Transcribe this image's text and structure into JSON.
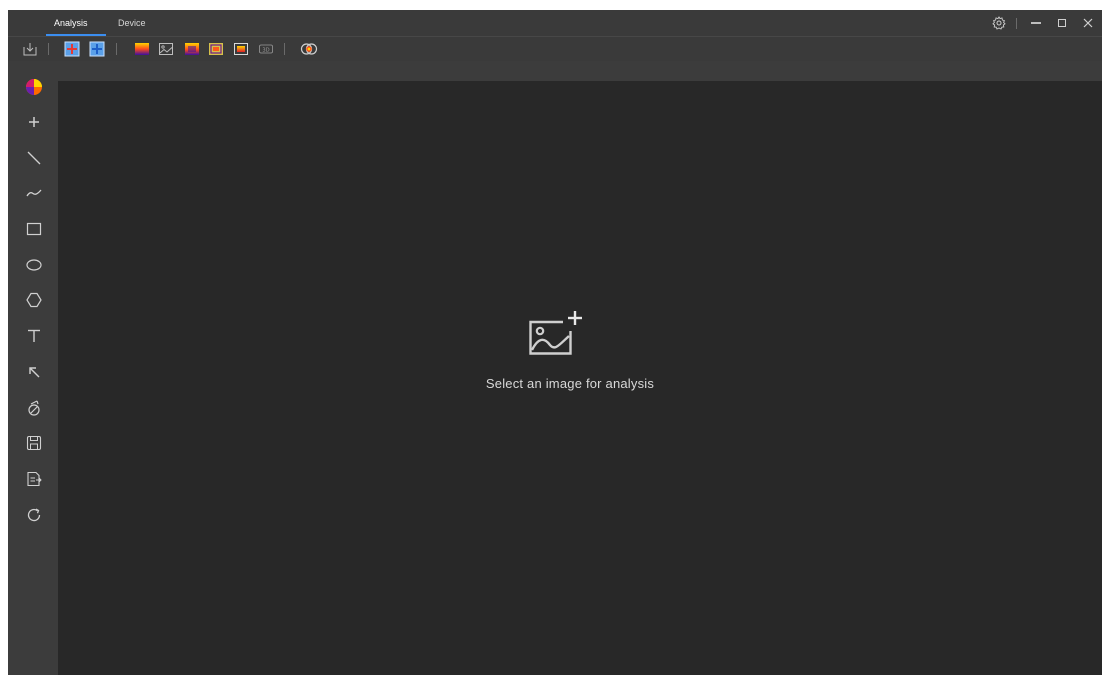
{
  "tabs": [
    {
      "label": "Analysis",
      "active": true
    },
    {
      "label": "Device",
      "active": false
    }
  ],
  "window_controls": {
    "settings_icon": "gear-icon",
    "minimize_icon": "minimize-icon",
    "maximize_icon": "maximize-icon",
    "close_icon": "close-icon"
  },
  "toolbar": {
    "items": [
      "import-icon",
      "add-point-red-icon",
      "add-point-blue-icon",
      "palette-gradient-icon",
      "image-icon",
      "palette-frame-icon",
      "palette-region-icon",
      "palette-box-icon",
      "3d-icon",
      "fusion-icon"
    ],
    "badge_3d": "3D"
  },
  "sidebar": {
    "tools": [
      "color-wheel-icon",
      "point-tool-icon",
      "line-tool-icon",
      "polyline-tool-icon",
      "rectangle-tool-icon",
      "ellipse-tool-icon",
      "polygon-tool-icon",
      "text-tool-icon",
      "arrow-tool-icon",
      "clear-tool-icon",
      "save-icon",
      "export-report-icon",
      "refresh-icon"
    ]
  },
  "main": {
    "placeholder_text": "Select an image for analysis",
    "placeholder_icon": "add-image-icon"
  },
  "colors": {
    "accent": "#3b8ef0",
    "canvas_bg": "#282828",
    "panel_bg": "#3c3c3c"
  }
}
